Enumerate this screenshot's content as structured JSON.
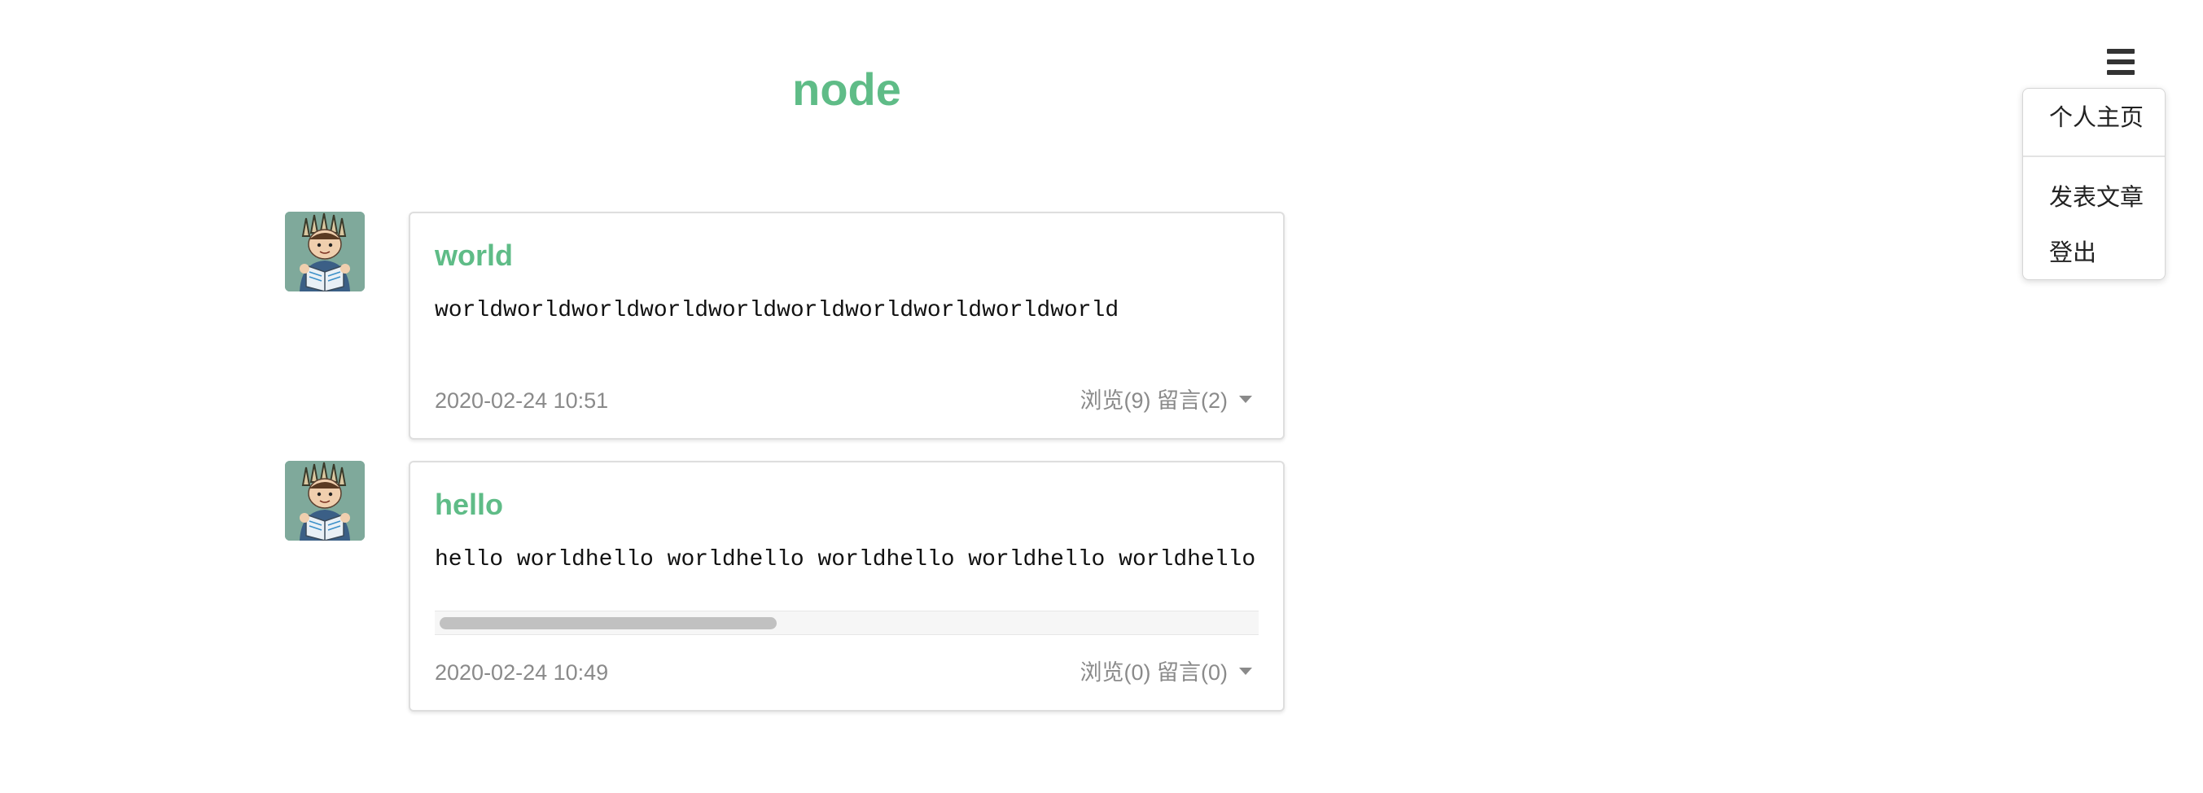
{
  "site": {
    "title": "node"
  },
  "menu": {
    "items": [
      "个人主页",
      "发表文章",
      "登出"
    ]
  },
  "posts": [
    {
      "title": "world",
      "body": "worldworldworldworldworldworldworldworldworldworld",
      "date": "2020-02-24 10:51",
      "stats": "浏览(9) 留言(2)"
    },
    {
      "title": "hello",
      "body": "hello worldhello worldhello worldhello worldhello worldhello",
      "date": "2020-02-24 10:49",
      "stats": "浏览(0) 留言(0)"
    }
  ],
  "colors": {
    "accent": "#5fbc87",
    "muted_text": "#8a8a8a",
    "border": "#dedede"
  },
  "icons": {
    "menu": "hamburger-menu-icon",
    "stats_toggle": "caret-down-icon"
  }
}
